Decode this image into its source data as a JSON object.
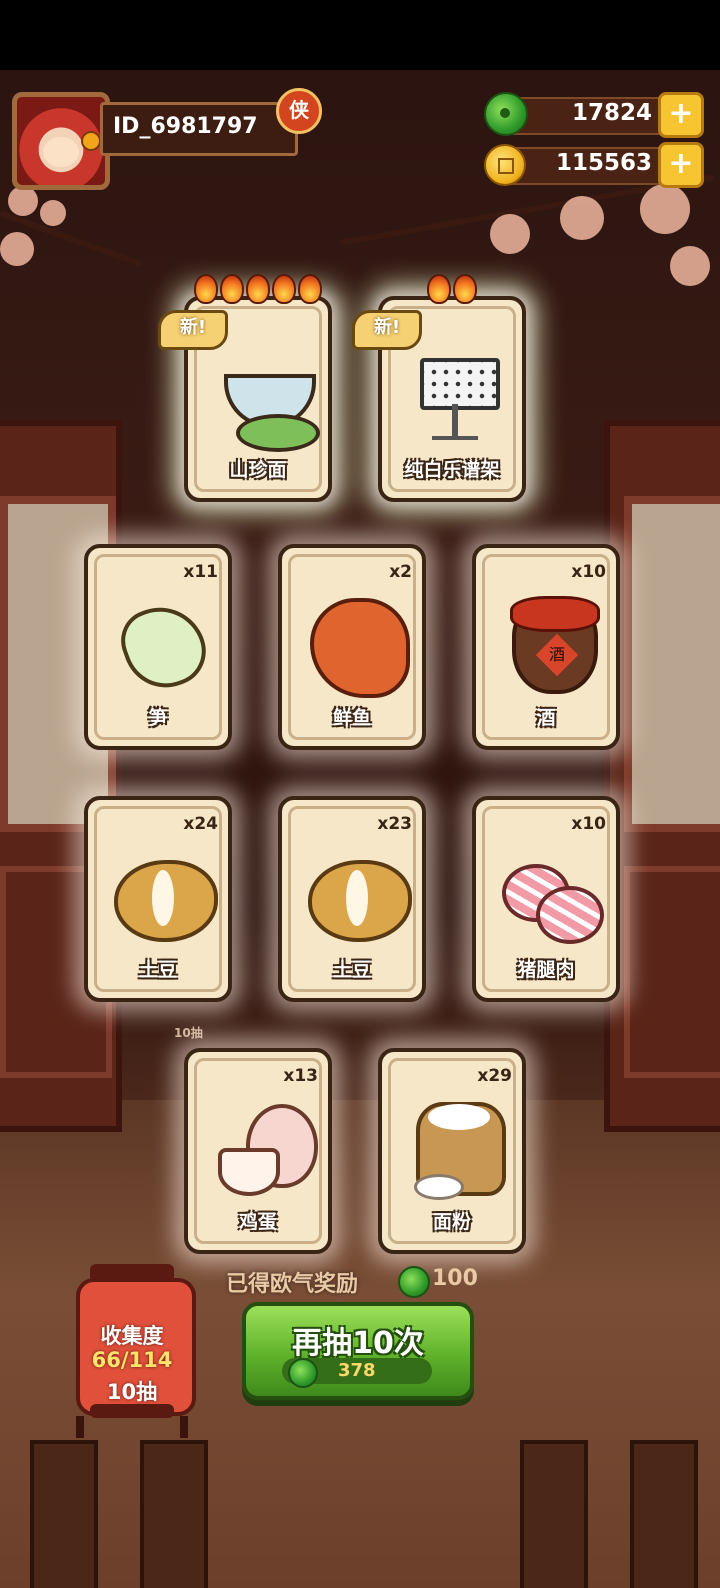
{
  "player": {
    "id": "ID_6981797",
    "vip_badge": "侠"
  },
  "currencies": {
    "jade": {
      "value": "17824",
      "icon": "jade-icon"
    },
    "coin": {
      "value": "115563",
      "icon": "coin-icon"
    },
    "add_label": "+"
  },
  "new_badge": "新!",
  "featured_cards": [
    {
      "name": "山珍面",
      "flames": 5,
      "is_new": true,
      "art": "noodle-bowl-icon"
    },
    {
      "name": "纯白乐谱架",
      "flames": 2,
      "is_new": true,
      "art": "music-stand-icon"
    }
  ],
  "cards": [
    {
      "name": "笋",
      "count": "x11",
      "art": "bamboo-shoot-icon"
    },
    {
      "name": "鲜鱼",
      "count": "x2",
      "art": "fish-icon"
    },
    {
      "name": "酒",
      "count": "x10",
      "art": "wine-jar-icon",
      "jar_label": "酒"
    },
    {
      "name": "土豆",
      "count": "x24",
      "art": "potato-icon"
    },
    {
      "name": "土豆",
      "count": "x23",
      "art": "potato-icon"
    },
    {
      "name": "猪腿肉",
      "count": "x10",
      "art": "pork-leg-icon"
    },
    {
      "name": "鸡蛋",
      "count": "x13",
      "art": "egg-icon"
    },
    {
      "name": "面粉",
      "count": "x29",
      "art": "flour-sack-icon"
    }
  ],
  "background_tag": "10抽",
  "reward": {
    "label": "已得欧气奖励",
    "value": "100",
    "icon": "jade-icon"
  },
  "draw_button": {
    "label": "再抽10次",
    "cost": "378",
    "icon": "jade-icon"
  },
  "collection": {
    "label": "收集度",
    "progress": "66/114",
    "draws": "10抽"
  }
}
